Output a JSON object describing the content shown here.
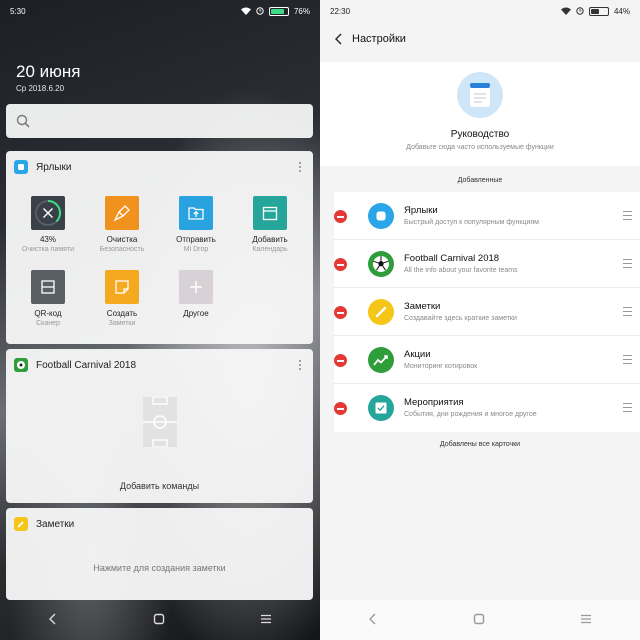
{
  "left": {
    "status": {
      "time": "5:30",
      "battery": "76%",
      "battery_level": 0.76
    },
    "date": "20 июня",
    "subdate": "Ср 2018.6.20",
    "shortcuts_card": {
      "title": "Ярлыки",
      "tiles": [
        {
          "label": "43%",
          "sub": "Очистка памяти",
          "icon": "close-icon",
          "color": "#3a4048"
        },
        {
          "label": "Очистка",
          "sub": "Безопасность",
          "icon": "broom-icon",
          "color": "#f0931e"
        },
        {
          "label": "Отправить",
          "sub": "Mi Drop",
          "icon": "upload-folder-icon",
          "color": "#29a3e0"
        },
        {
          "label": "Добавить",
          "sub": "Календарь",
          "icon": "calendar-icon",
          "color": "#26a69a"
        },
        {
          "label": "QR-код",
          "sub": "Сканер",
          "icon": "qr-scan-icon",
          "color": "#5a5f66"
        },
        {
          "label": "Создать",
          "sub": "Заметки",
          "icon": "note-icon",
          "color": "#f4a91f"
        },
        {
          "label": "Другое",
          "sub": "",
          "icon": "plus-icon",
          "color": "#d8d2d6"
        }
      ]
    },
    "football_card": {
      "title": "Football Carnival 2018",
      "add_label": "Добавить команды"
    },
    "notes_card": {
      "title": "Заметки",
      "hint": "Нажмите для создания заметки"
    }
  },
  "right": {
    "status": {
      "time": "22:30",
      "battery": "44%",
      "battery_level": 0.44
    },
    "header_title": "Настройки",
    "hero": {
      "title": "Руководство",
      "subtitle": "Добавьте сюда часто используемые функции"
    },
    "added_label": "Добавленные",
    "items": [
      {
        "title": "Ярлыки",
        "desc": "Быстрый доступ к популярным функциям",
        "icon": "shortcuts-icon",
        "color": "#2aa6e8"
      },
      {
        "title": "Football Carnival 2018",
        "desc": "All the info about your favorite teams",
        "icon": "soccer-ball-icon",
        "color": "#2e9d3a"
      },
      {
        "title": "Заметки",
        "desc": "Создавайте здесь краткие заметки",
        "icon": "pencil-icon",
        "color": "#f5c518"
      },
      {
        "title": "Акции",
        "desc": "Мониторинг котировок",
        "icon": "stocks-chart-icon",
        "color": "#2e9d3a"
      },
      {
        "title": "Мероприятия",
        "desc": "События, дни рождения и многое другое",
        "icon": "event-check-icon",
        "color": "#26a69a"
      }
    ],
    "footer_label": "Добавлены все карточки"
  }
}
